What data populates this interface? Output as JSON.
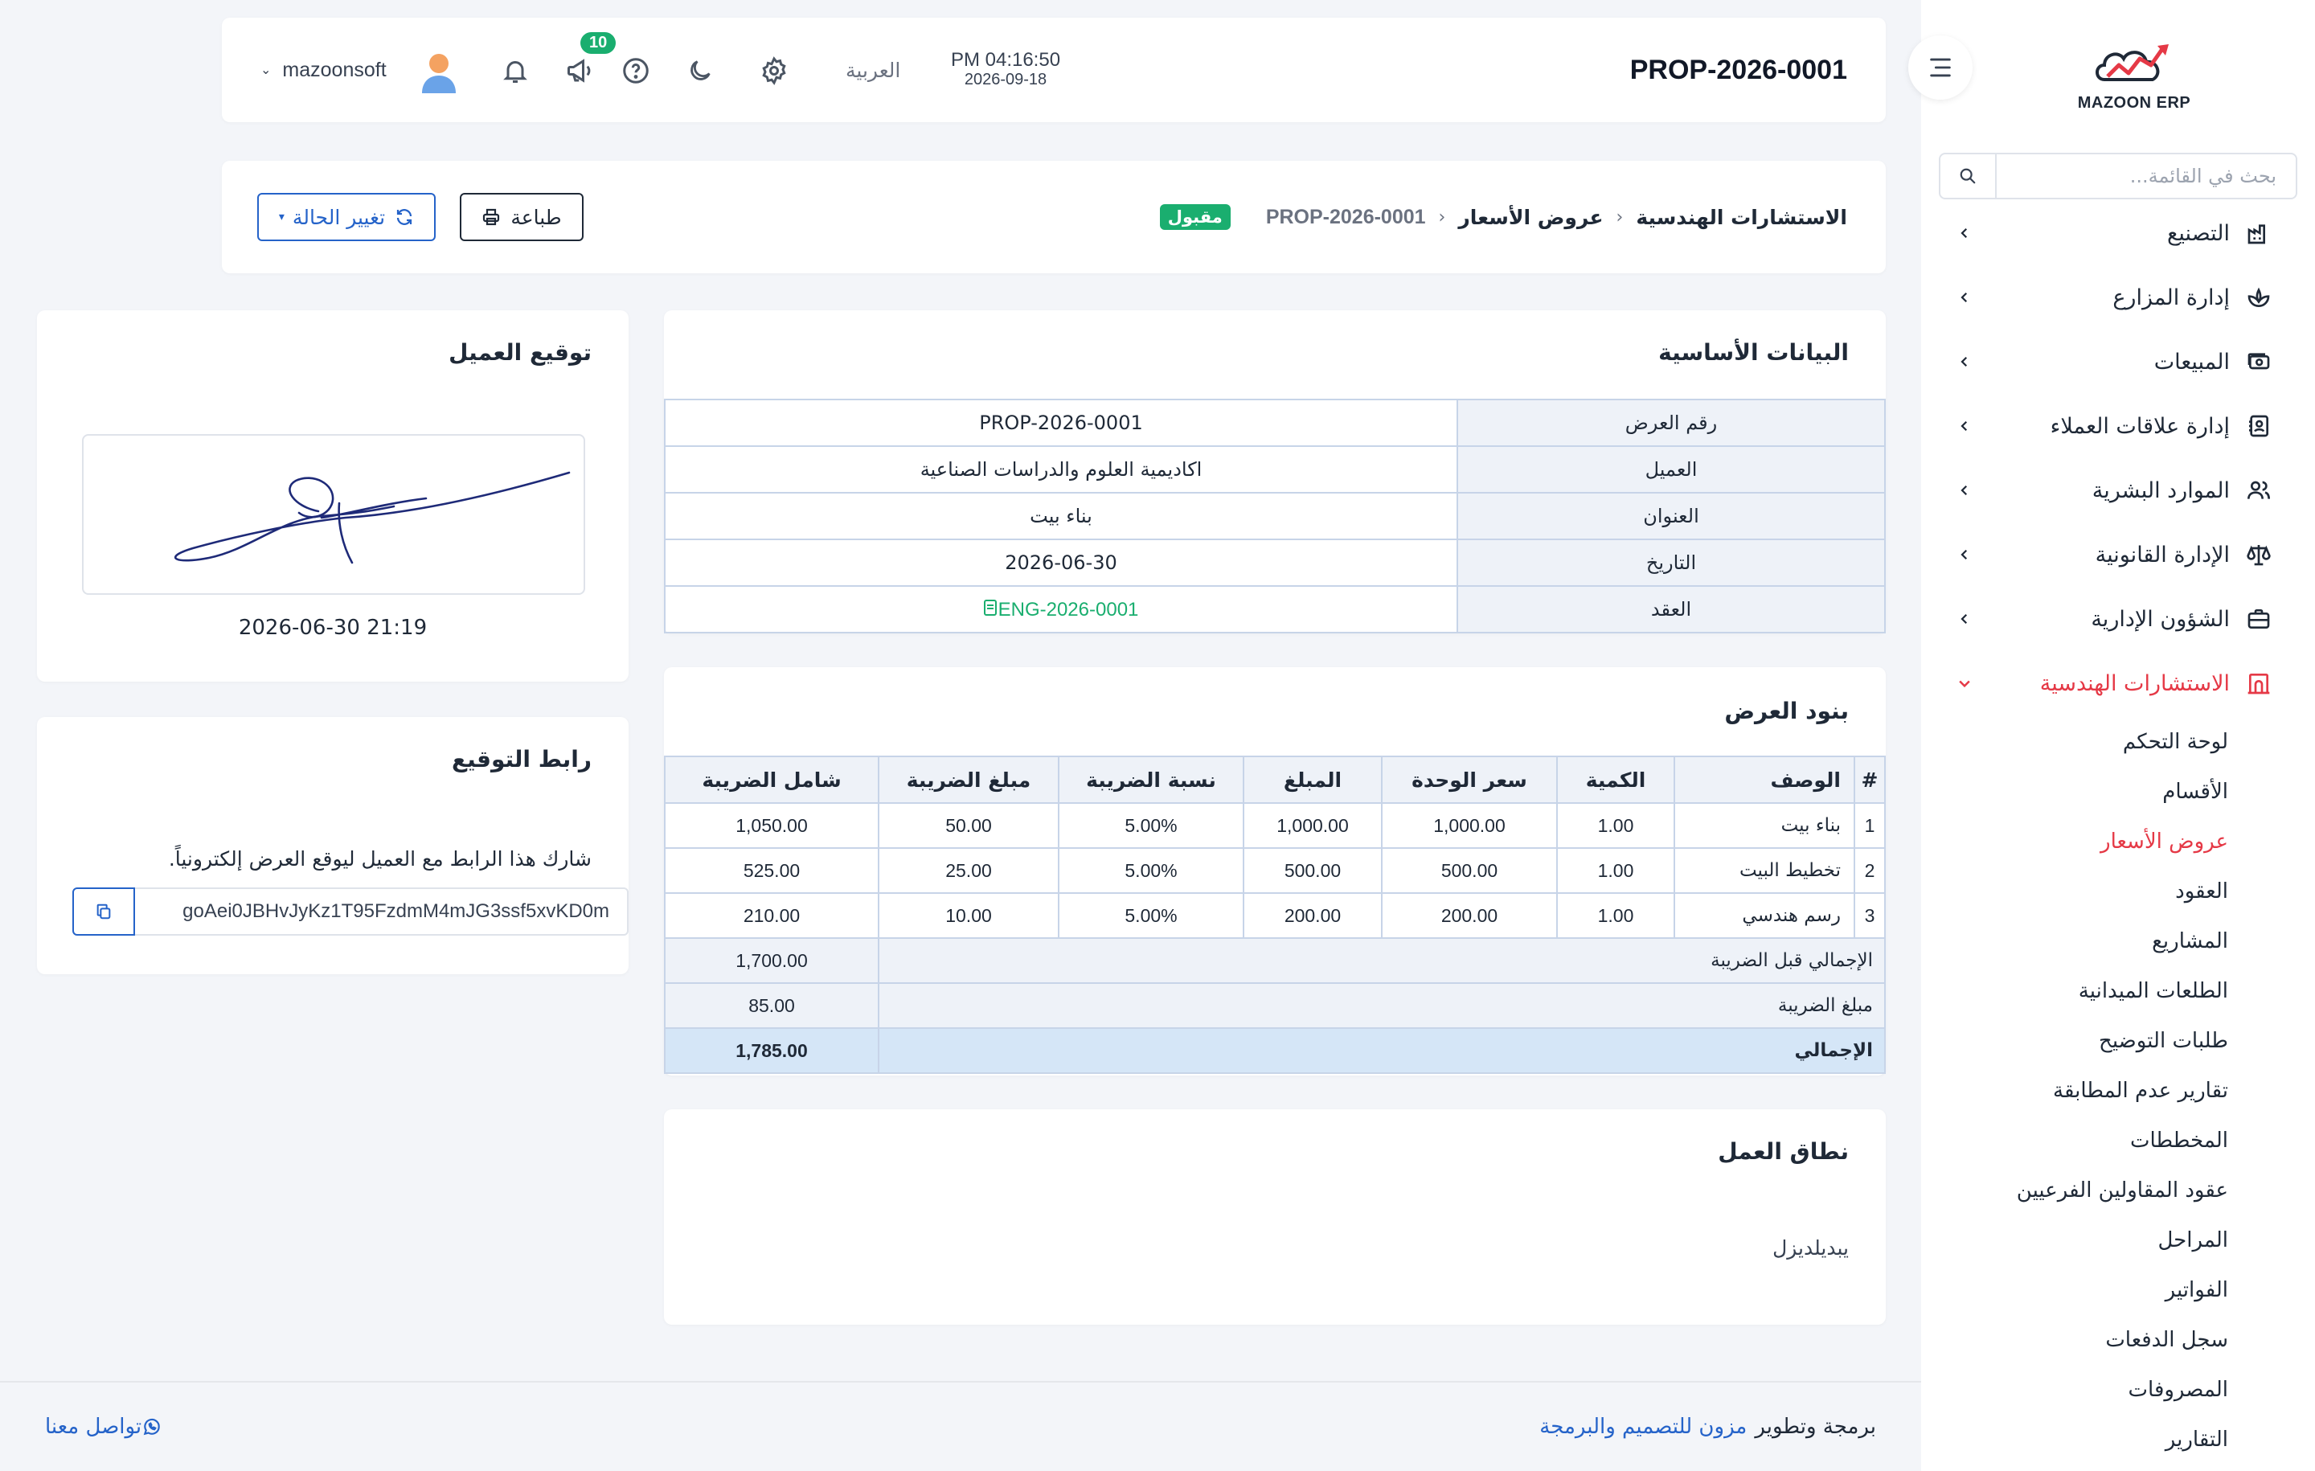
{
  "app": {
    "logo_text": "MAZOON ERP"
  },
  "header": {
    "title": "PROP-2026-0001",
    "time": "PM 04:16:50",
    "date": "2026-09-18",
    "language": "العربية",
    "notification_count": "10",
    "user_name": "mazoonsoft"
  },
  "sidebar": {
    "search_placeholder": "بحث في القائمة...",
    "items": [
      {
        "label": "التصنيع",
        "icon": "factory-icon"
      },
      {
        "label": "إدارة المزارع",
        "icon": "plant-icon"
      },
      {
        "label": "المبيعات",
        "icon": "cash-icon"
      },
      {
        "label": "إدارة علاقات العملاء",
        "icon": "contacts-icon"
      },
      {
        "label": "الموارد البشرية",
        "icon": "users-icon"
      },
      {
        "label": "الإدارة القانونية",
        "icon": "scale-icon"
      },
      {
        "label": "الشؤون الإدارية",
        "icon": "briefcase-icon"
      },
      {
        "label": "الاستشارات الهندسية",
        "icon": "building-icon"
      }
    ],
    "subitems": [
      "لوحة التحكم",
      "الأقسام",
      "عروض الأسعار",
      "العقود",
      "المشاريع",
      "الطلعات الميدانية",
      "طلبات التوضيح",
      "تقارير عدم المطابقة",
      "المخططات",
      "عقود المقاولين الفرعيين",
      "المراحل",
      "الفواتير",
      "سجل الدفعات",
      "المصروفات",
      "التقارير"
    ]
  },
  "breadcrumb": {
    "level1": "الاستشارات الهندسية",
    "level2": "عروض الأسعار",
    "current": "PROP-2026-0001",
    "status": "مقبول"
  },
  "actions": {
    "print": "طباعة",
    "change_status": "تغيير الحالة"
  },
  "basic_info": {
    "title": "البيانات الأساسية",
    "rows": [
      {
        "label": "رقم العرض",
        "value": "PROP-2026-0001"
      },
      {
        "label": "العميل",
        "value": "اكاديمية العلوم والدراسات الصناعية"
      },
      {
        "label": "العنوان",
        "value": "بناء بيت"
      },
      {
        "label": "التاريخ",
        "value": "2026-06-30"
      },
      {
        "label": "العقد",
        "value": "ENG-2026-0001"
      }
    ]
  },
  "items": {
    "title": "بنود العرض",
    "headers": [
      "#",
      "الوصف",
      "الكمية",
      "سعر الوحدة",
      "المبلغ",
      "نسبة الضريبة",
      "مبلغ الضريبة",
      "شامل الضريبة"
    ],
    "rows": [
      [
        "1",
        "بناء بيت",
        "1.00",
        "1,000.00",
        "1,000.00",
        "5.00%",
        "50.00",
        "1,050.00"
      ],
      [
        "2",
        "تخطيط البيت",
        "1.00",
        "500.00",
        "500.00",
        "5.00%",
        "25.00",
        "525.00"
      ],
      [
        "3",
        "رسم هندسي",
        "1.00",
        "200.00",
        "200.00",
        "5.00%",
        "10.00",
        "210.00"
      ]
    ],
    "subtotal_label": "الإجمالي قبل الضريبة",
    "subtotal": "1,700.00",
    "tax_label": "مبلغ الضريبة",
    "tax": "85.00",
    "total_label": "الإجمالي",
    "total": "1,785.00"
  },
  "scope": {
    "title": "نطاق العمل",
    "text": "يبديلديزل"
  },
  "signature": {
    "title": "توقيع العميل",
    "date": "2026-06-30 21:19"
  },
  "sign_link": {
    "title": "رابط التوقيع",
    "description": "شارك هذا الرابط مع العميل ليوقع العرض إلكترونياً.",
    "value": "goAei0JBHvJyKz1T95FzdmM4mJG3ssf5xvKD0m"
  },
  "footer": {
    "credit": "برمجة وتطوير",
    "brand": "مزون للتصميم والبرمجة",
    "contact": "تواصل معنا"
  },
  "colors": {
    "accent": "#2563c9",
    "active": "#e53946",
    "success": "#1aae6f"
  }
}
